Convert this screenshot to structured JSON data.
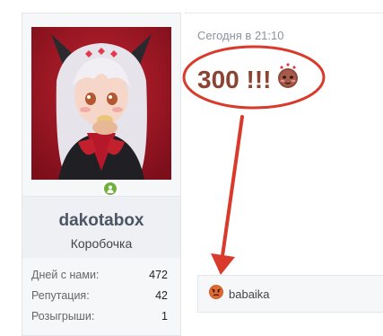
{
  "user": {
    "username": "dakotabox",
    "user_title": "Коробочка",
    "online_status": "online",
    "stats": [
      {
        "label": "Дней с нами:",
        "value": "472"
      },
      {
        "label": "Репутация:",
        "value": "42"
      },
      {
        "label": "Розыгрыши:",
        "value": "1"
      }
    ]
  },
  "post": {
    "timestamp": "Сегодня в 21:10",
    "message": "300 !!!",
    "message_emoji": "shy-blushing-emoji"
  },
  "reactions": {
    "icon": "angry-face-emoji",
    "users": "babaika"
  },
  "colors": {
    "annotation_red": "#d93a2b",
    "message_text": "#8a4431",
    "online_green": "#6fb23a",
    "avatar_background": "#9e1626"
  }
}
